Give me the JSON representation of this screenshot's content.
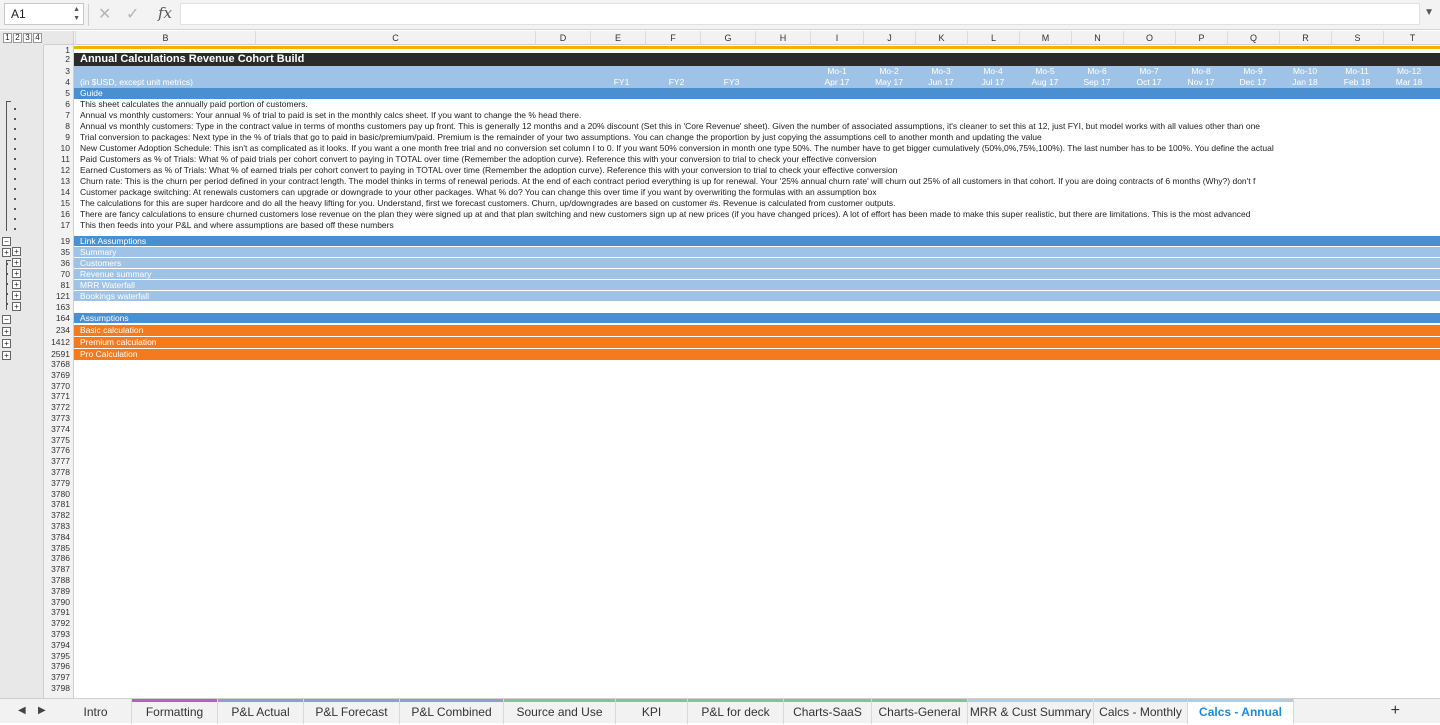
{
  "formula_bar": {
    "name_box": "A1",
    "formula": ""
  },
  "columns": [
    "B",
    "C",
    "D",
    "E",
    "F",
    "G",
    "H",
    "I",
    "J",
    "K",
    "L",
    "M",
    "N",
    "O",
    "P",
    "Q",
    "R",
    "S",
    "T"
  ],
  "outline_levels": [
    "1",
    "2",
    "3",
    "4"
  ],
  "title": "Annual Calculations Revenue Cohort Build",
  "units_label": "(in $USD, except unit metrics)",
  "fiscal_years": [
    "FY1",
    "FY2",
    "FY3"
  ],
  "months_top": [
    "Mo-1",
    "Mo-2",
    "Mo-3",
    "Mo-4",
    "Mo-5",
    "Mo-6",
    "Mo-7",
    "Mo-8",
    "Mo-9",
    "Mo-10",
    "Mo-11",
    "Mo-12"
  ],
  "months_bottom": [
    "Apr 17",
    "May 17",
    "Jun 17",
    "Jul 17",
    "Aug 17",
    "Sep 17",
    "Oct 17",
    "Nov 17",
    "Dec 17",
    "Jan 18",
    "Feb 18",
    "Mar 18"
  ],
  "guide_label": "Guide",
  "guide_lines": [
    "This sheet calculates the annually paid portion of customers.",
    "Annual vs monthly customers: Your annual % of trial to paid is set in the monthly calcs sheet. If you want to change the % head there.",
    "Annual vs monthly customers: Type in the contract value in terms of months customers pay up front. This is generally 12 months and a 20% discount (Set this in 'Core Revenue' sheet). Given the number of associated assumptions, it's cleaner to set this at 12, just FYI, but model works with all values other than one",
    "Trial conversion to packages: Next type in the % of trials that go to paid in basic/premium/paid. Premium is the remainder of your two assumptions. You can change the proportion by just copying the assumptions cell to another month and updating the value",
    "New Customer Adoption Schedule: This isn't as complicated as it looks. If you want a one month free trial and no conversion set column I to 0. If you want 50% conversion in month one type 50%. The number have to get bigger cumulatively (50%,0%,75%,100%). The last number has to be 100%. You define the actual",
    "Paid Customers as % of Trials: What % of paid trials per cohort convert to paying in TOTAL over time (Remember the adoption curve). Reference this with your conversion to trial to check your effective conversion",
    "Earned Customers as % of Trials: What % of earned trials per cohort convert to paying in TOTAL over time (Remember the adoption curve). Reference this with your conversion to trial to check your effective conversion",
    "Churn rate: This is the churn per period defined in your contract length. The model thinks in terms of renewal periods. At the end of each contract period everything is up for renewal. Your '25% annual churn rate' will churn out 25% of all customers in that cohort.  If you are doing contracts of 6 months (Why?) don't f",
    "Customer package switching: At renewals customers can upgrade or downgrade to your other packages. What % do? You can change this over time if you want by overwriting the formulas with an assumption box",
    "The calculations for this are super hardcore and do all the heavy lifting for you. Understand, first we forecast customers. Churn, up/downgrades are based on customer #s.  Revenue is calculated from customer outputs.",
    "There are fancy calculations to ensure churned customers lose revenue on the plan they were signed up at and that plan switching and new customers sign up at new prices (if you have changed prices). A lot of effort has been made to make this super realistic, but there are limitations. This is the most advanced",
    "This then feeds into your P&L and where assumptions are based off these numbers"
  ],
  "row_numbers": {
    "top": [
      "1",
      "2",
      "3",
      "4",
      "5",
      "6",
      "7",
      "8",
      "9",
      "10",
      "11",
      "12",
      "13",
      "14",
      "15",
      "16",
      "17"
    ],
    "sections": [
      "19",
      "35",
      "36",
      "70",
      "81",
      "121",
      "163",
      "164",
      "234",
      "1412",
      "2591"
    ],
    "tail": [
      "3768",
      "3769",
      "3770",
      "3771",
      "3772",
      "3773",
      "3774",
      "3775",
      "3776",
      "3777",
      "3778",
      "3779",
      "3780",
      "3781",
      "3782",
      "3783",
      "3784",
      "3785",
      "3786",
      "3787",
      "3788",
      "3789",
      "3790",
      "3791",
      "3792",
      "3793",
      "3794",
      "3795",
      "3796",
      "3797",
      "3798"
    ]
  },
  "sections": [
    {
      "label": "Link Assumptions",
      "style": "midblue"
    },
    {
      "label": "Summary",
      "style": "lightblue"
    },
    {
      "label": "Customers",
      "style": "lightblue"
    },
    {
      "label": "Revenue summary",
      "style": "lightblue"
    },
    {
      "label": "MRR Waterfall",
      "style": "lightblue"
    },
    {
      "label": "Bookings waterfall",
      "style": "lightblue"
    },
    {
      "label": "",
      "style": "blank"
    },
    {
      "label": "Assumptions",
      "style": "midblue"
    },
    {
      "label": "Basic calculation",
      "style": "orange"
    },
    {
      "label": "Premium calculation",
      "style": "orange"
    },
    {
      "label": "Pro Calculation",
      "style": "orange"
    }
  ],
  "tabs": [
    {
      "label": "Intro",
      "color": ""
    },
    {
      "label": "Formatting",
      "color": "#b65fc4"
    },
    {
      "label": "P&L Actual",
      "color": "#8aa0d0"
    },
    {
      "label": "P&L Forecast",
      "color": "#8aa0d0"
    },
    {
      "label": "P&L Combined",
      "color": "#8aa0d0"
    },
    {
      "label": "Source and Use",
      "color": "#7cc98a"
    },
    {
      "label": "KPI",
      "color": "#7cc98a"
    },
    {
      "label": "P&L for deck",
      "color": "#7cc98a"
    },
    {
      "label": "Charts-SaaS",
      "color": "#7cc98a"
    },
    {
      "label": "Charts-General",
      "color": "#7cc98a"
    },
    {
      "label": "MRR & Cust Summary",
      "color": "#a6d0f0"
    },
    {
      "label": "Calcs - Monthly",
      "color": "#a6d0f0"
    },
    {
      "label": "Calcs - Annual",
      "color": "#a6d0f0"
    }
  ],
  "active_tab": "Calcs - Annual",
  "colors": {
    "title_bar": "#2b2b2b",
    "section_blue": "#4a90d0",
    "section_light": "#9ec3e6",
    "section_orange": "#f47a1e",
    "accent_yellow": "#f0b400",
    "active_tab": "#1a8cd8"
  }
}
